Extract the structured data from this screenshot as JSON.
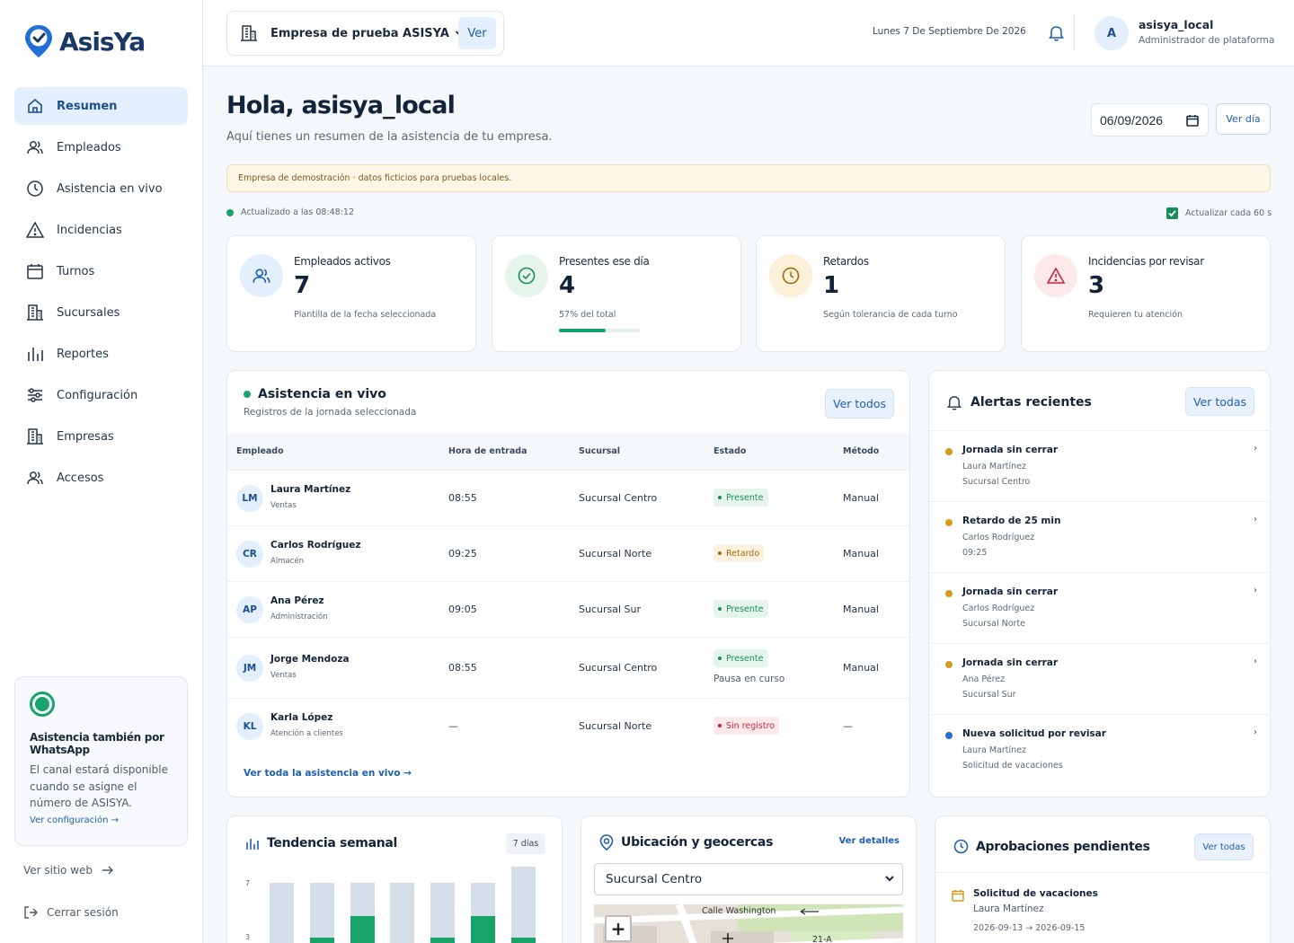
{
  "brand": {
    "name": "AsisYa"
  },
  "sidebar": {
    "items": [
      {
        "label": "Resumen",
        "icon": "home-icon",
        "active": true
      },
      {
        "label": "Empleados",
        "icon": "users-icon"
      },
      {
        "label": "Asistencia en vivo",
        "icon": "clock-icon"
      },
      {
        "label": "Incidencias",
        "icon": "warning-icon"
      },
      {
        "label": "Turnos",
        "icon": "calendar-icon"
      },
      {
        "label": "Sucursales",
        "icon": "building-icon"
      },
      {
        "label": "Reportes",
        "icon": "bar-chart-icon"
      },
      {
        "label": "Configuración",
        "icon": "sliders-icon"
      },
      {
        "label": "Empresas",
        "icon": "building-icon"
      },
      {
        "label": "Accesos",
        "icon": "users-icon"
      }
    ],
    "whatsapp": {
      "title": "Asistencia también por WhatsApp",
      "body": "El canal estará disponible cuando se asigne el número de ASISYA.",
      "link": "Ver configuración →"
    },
    "site_link": "Ver sitio web",
    "logout": "Cerrar sesión"
  },
  "topbar": {
    "company": "Empresa de prueba ASISYA",
    "company_button": "Ver",
    "date": "Lunes 7 De Septiembre De 2026",
    "avatar": "A",
    "user": "asisya_local",
    "role": "Administrador de plataforma"
  },
  "header": {
    "greeting": "Hola, asisya_local",
    "subtitle": "Aquí tienes un resumen de la asistencia de tu empresa.",
    "date_value": "06/09/2026",
    "day_button": "Ver día"
  },
  "banner": "Empresa de demostración · datos ficticios para pruebas locales.",
  "status": {
    "updated": "Actualizado a las 08:48:12",
    "auto": "Actualizar cada 60 s",
    "auto_checked": true
  },
  "kpis": [
    {
      "label": "Empleados activos",
      "value": "7",
      "note": "Plantilla de la fecha seleccionada",
      "icon": "users-icon",
      "color": "#e3effd"
    },
    {
      "label": "Presentes ese día",
      "value": "4",
      "note": "57% del total",
      "icon": "check-circle-icon",
      "color": "#e5f5ec",
      "progress": 0.57
    },
    {
      "label": "Retardos",
      "value": "1",
      "note": "Según tolerancia de cada turno",
      "icon": "clock-icon",
      "color": "#fdf0d8"
    },
    {
      "label": "Incidencias por revisar",
      "value": "3",
      "note": "Requieren tu atención",
      "icon": "warning-icon",
      "color": "#fde8ea"
    }
  ],
  "live": {
    "title": "Asistencia en vivo",
    "subtitle": "Registros de la jornada seleccionada",
    "button": "Ver todos",
    "columns": [
      "Empleado",
      "Hora de entrada",
      "Sucursal",
      "Estado",
      "Método"
    ],
    "rows": [
      {
        "initials": "LM",
        "name": "Laura Martínez",
        "dept": "Ventas",
        "time": "08:55",
        "branch": "Sucursal Centro",
        "status": "Presente",
        "kind": "ok",
        "note": "",
        "method": "Manual"
      },
      {
        "initials": "CR",
        "name": "Carlos Rodríguez",
        "dept": "Almacén",
        "time": "09:25",
        "branch": "Sucursal Norte",
        "status": "Retardo",
        "kind": "late",
        "note": "",
        "method": "Manual"
      },
      {
        "initials": "AP",
        "name": "Ana Pérez",
        "dept": "Administración",
        "time": "09:05",
        "branch": "Sucursal Sur",
        "status": "Presente",
        "kind": "ok",
        "note": "",
        "method": "Manual"
      },
      {
        "initials": "JM",
        "name": "Jorge Mendoza",
        "dept": "Ventas",
        "time": "08:55",
        "branch": "Sucursal Centro",
        "status": "Presente",
        "kind": "ok",
        "note": "Pausa en curso",
        "method": "Manual"
      },
      {
        "initials": "KL",
        "name": "Karla López",
        "dept": "Atención a clientes",
        "time": "—",
        "branch": "Sucursal Norte",
        "status": "Sin registro",
        "kind": "none",
        "note": "",
        "method": "—"
      }
    ],
    "footer_link": "Ver toda la asistencia en vivo →"
  },
  "alerts": {
    "title": "Alertas recientes",
    "button": "Ver todas",
    "items": [
      {
        "title": "Jornada sin cerrar",
        "line1": "Laura Martínez",
        "line2": "Sucursal Centro",
        "color": "#d49a1a"
      },
      {
        "title": "Retardo de 25 min",
        "line1": "Carlos Rodríguez",
        "line2": "09:25",
        "color": "#d49a1a"
      },
      {
        "title": "Jornada sin cerrar",
        "line1": "Carlos Rodríguez",
        "line2": "Sucursal Norte",
        "color": "#d49a1a"
      },
      {
        "title": "Jornada sin cerrar",
        "line1": "Ana Pérez",
        "line2": "Sucursal Sur",
        "color": "#d49a1a"
      },
      {
        "title": "Nueva solicitud por revisar",
        "line1": "Laura Martínez",
        "line2": "Solicitud de vacaciones",
        "color": "#1f6fd6"
      }
    ]
  },
  "trend": {
    "title": "Tendencia semanal",
    "chip": "7 días",
    "chart_data": {
      "type": "bar",
      "y_ticks": [
        "7",
        "3"
      ],
      "ylim": [
        0,
        7
      ],
      "series": [
        {
          "values": [
            7,
            7,
            7,
            7,
            7,
            7,
            7
          ]
        },
        {
          "values": [
            0,
            2,
            4,
            0,
            2,
            4,
            2
          ]
        }
      ]
    }
  },
  "geo": {
    "title": "Ubicación y geocercas",
    "link": "Ver detalles",
    "select": "Sucursal Centro",
    "map_labels": [
      "Calle Washington",
      "21-A"
    ],
    "zoom": "+"
  },
  "approvals": {
    "title": "Aprobaciones pendientes",
    "button": "Ver todas",
    "item": {
      "title": "Solicitud de vacaciones",
      "person": "Laura Martínez",
      "dates": "2026-09-13 → 2026-09-15"
    }
  }
}
